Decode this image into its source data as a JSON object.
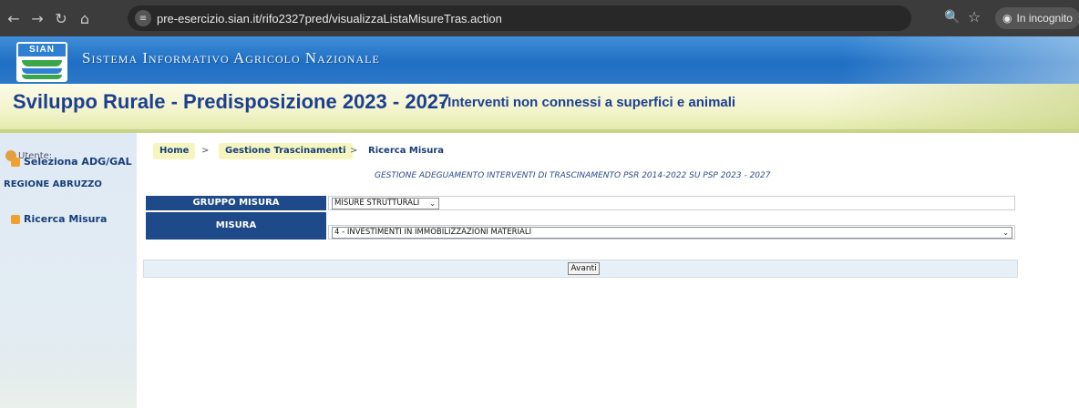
{
  "browser": {
    "url": "pre-esercizio.sian.it/rifo2327pred/visualizzaListaMisureTras.action",
    "incognito_label": "In incognito",
    "back_icon": "back-arrow-icon",
    "forward_icon": "forward-arrow-icon",
    "reload_icon": "reload-icon",
    "home_icon": "home-icon"
  },
  "header": {
    "logo_text": "SIAN",
    "system_title": "Sistema Informativo Agricolo Nazionale",
    "program_title": "Sviluppo Rurale - Predisposizione 2023 - 2027",
    "program_subtitle": "- Interventi non connessi a superfici e animali"
  },
  "sidebar": {
    "user_label": "Utente:",
    "select_link": "Seleziona ADG/GAL",
    "region": "REGIONE ABRUZZO",
    "search_link": "Ricerca Misura"
  },
  "breadcrumb": {
    "home": "Home",
    "separator": ">",
    "section": "Gestione Trascinamenti",
    "current": "Ricerca Misura"
  },
  "main": {
    "heading": "GESTIONE ADEGUAMENTO INTERVENTI DI TRASCINAMENTO PSR 2014-2022 SU PSP 2023 - 2027",
    "gruppo_label": "GRUPPO MISURA",
    "gruppo_value": "MISURE STRUTTURALI",
    "misura_label": "MISURA",
    "misura_value": "4 - INVESTIMENTI IN IMMOBILIZZAZIONI MATERIALI",
    "submit_label": "Avanti"
  },
  "colors": {
    "header_blue": "#1f6fc4",
    "title_blue": "#1d3f8f",
    "label_cell_bg": "#1f4a8a",
    "crumb_bg": "#f5f5bf",
    "bullet_orange": "#f0a030"
  }
}
